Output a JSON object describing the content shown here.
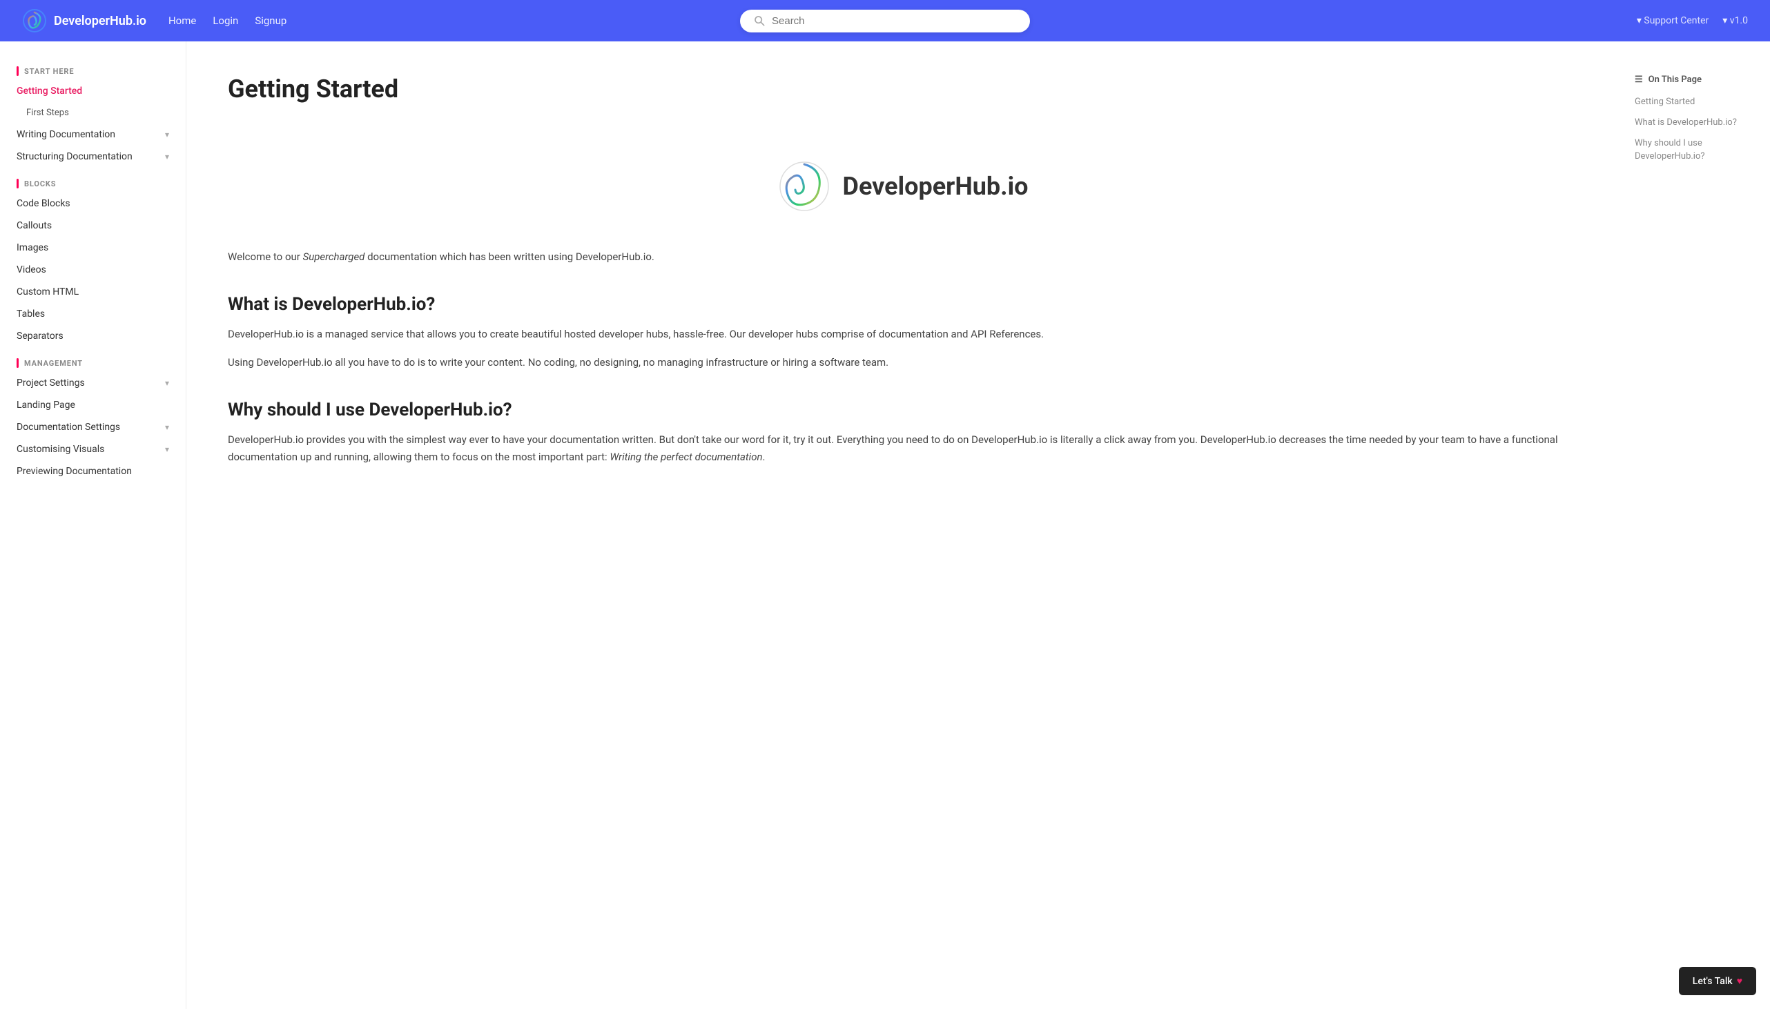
{
  "navbar": {
    "brand": "DeveloperHub.io",
    "links": [
      "Home",
      "Login",
      "Signup"
    ],
    "support_center": "Support Center",
    "version": "v1.0"
  },
  "search": {
    "placeholder": "Search"
  },
  "sidebar": {
    "sections": [
      {
        "label": "START HERE",
        "items": [
          {
            "id": "getting-started",
            "label": "Getting Started",
            "active": true,
            "sub": false
          },
          {
            "id": "first-steps",
            "label": "First Steps",
            "active": false,
            "sub": true
          }
        ]
      },
      {
        "label": "",
        "items": [
          {
            "id": "writing-documentation",
            "label": "Writing Documentation",
            "active": false,
            "sub": false,
            "chevron": true
          },
          {
            "id": "structuring-documentation",
            "label": "Structuring Documentation",
            "active": false,
            "sub": false,
            "chevron": true
          }
        ]
      },
      {
        "label": "BLOCKS",
        "items": [
          {
            "id": "code-blocks",
            "label": "Code Blocks",
            "active": false,
            "sub": false
          },
          {
            "id": "callouts",
            "label": "Callouts",
            "active": false,
            "sub": false
          },
          {
            "id": "images",
            "label": "Images",
            "active": false,
            "sub": false
          },
          {
            "id": "videos",
            "label": "Videos",
            "active": false,
            "sub": false
          },
          {
            "id": "custom-html",
            "label": "Custom HTML",
            "active": false,
            "sub": false
          },
          {
            "id": "tables",
            "label": "Tables",
            "active": false,
            "sub": false
          },
          {
            "id": "separators",
            "label": "Separators",
            "active": false,
            "sub": false
          }
        ]
      },
      {
        "label": "MANAGEMENT",
        "items": [
          {
            "id": "project-settings",
            "label": "Project Settings",
            "active": false,
            "sub": false,
            "chevron": true
          },
          {
            "id": "landing-page",
            "label": "Landing Page",
            "active": false,
            "sub": false
          },
          {
            "id": "documentation-settings",
            "label": "Documentation Settings",
            "active": false,
            "sub": false,
            "chevron": true
          },
          {
            "id": "customising-visuals",
            "label": "Customising Visuals",
            "active": false,
            "sub": false,
            "chevron": true
          },
          {
            "id": "previewing-documentation",
            "label": "Previewing Documentation",
            "active": false,
            "sub": false
          }
        ]
      }
    ]
  },
  "page": {
    "title": "Getting Started",
    "brand_name": "DeveloperHub.io",
    "intro_text_1_plain": "Welcome to our ",
    "intro_text_1_italic": "Supercharged",
    "intro_text_1_rest": " documentation which has been written using DeveloperHub.io.",
    "section1_heading": "What is DeveloperHub.io?",
    "section1_para1": "DeveloperHub.io is a managed service that allows you to create beautiful hosted developer hubs, hassle-free. Our developer hubs comprise of documentation and API References.",
    "section1_para2": "Using DeveloperHub.io all you have to do is to write your content. No coding, no designing, no managing infrastructure or hiring a software team.",
    "section2_heading": "Why should I use DeveloperHub.io?",
    "section2_para1_plain": "DeveloperHub.io provides you with the simplest way ever to have your documentation written. But don't take our word for it, try it out. Everything you need to do on DeveloperHub.io is literally a click away from you. DeveloperHub.io decreases the time needed by your team to have a functional documentation up and running, allowing them to focus on the most important part: ",
    "section2_para1_italic": "Writing the perfect documentation",
    "section2_para1_end": "."
  },
  "on_this_page": {
    "title": "On This Page",
    "links": [
      "Getting Started",
      "What is DeveloperHub.io?",
      "Why should I use DeveloperHub.io?"
    ]
  },
  "lets_talk": {
    "label": "Let's Talk"
  }
}
